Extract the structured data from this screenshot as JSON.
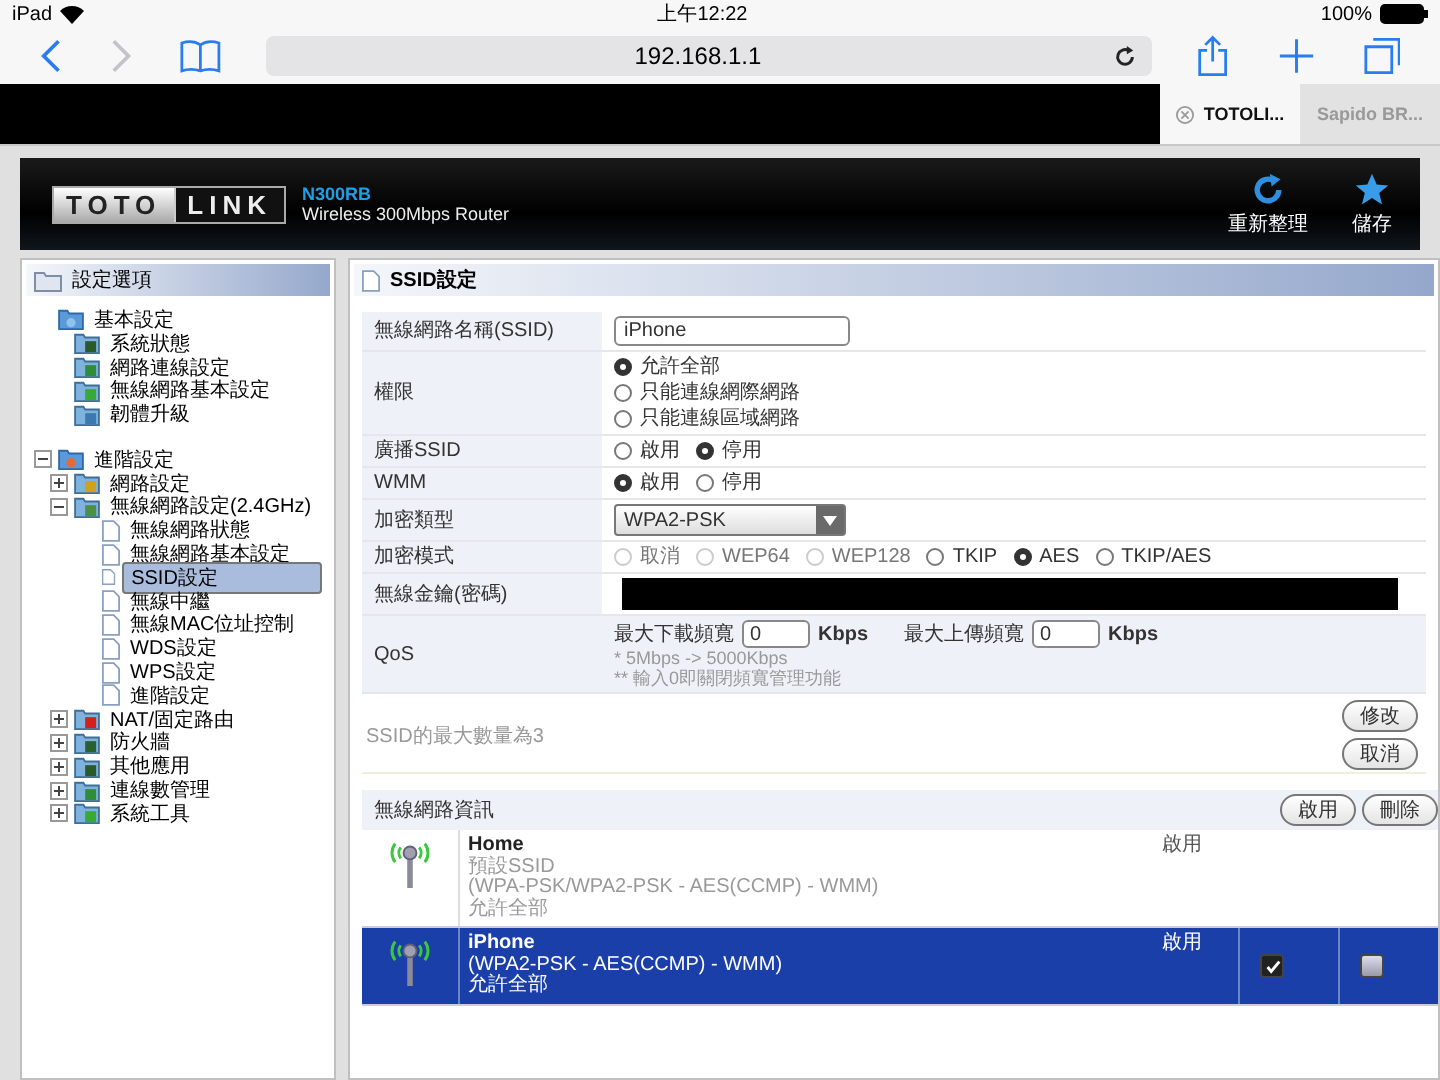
{
  "status_bar": {
    "device": "iPad",
    "time": "上午12:22",
    "battery": "100%"
  },
  "browser": {
    "url": "192.168.1.1",
    "tabs": [
      {
        "label": "TOTOLI...",
        "selected": true
      },
      {
        "label": "Sapido BR...",
        "selected": false
      }
    ]
  },
  "header": {
    "logo_left": "TOTO",
    "logo_right": "LINK",
    "model": "N300RB",
    "subtitle": "Wireless 300Mbps Router",
    "actions": [
      {
        "kind": "refresh",
        "label": "重新整理"
      },
      {
        "kind": "save",
        "label": "儲存"
      }
    ]
  },
  "sidebar": {
    "title": "設定選項",
    "tree": [
      {
        "label": "基本設定",
        "children": [
          {
            "label": "系統狀態"
          },
          {
            "label": "網路連線設定"
          },
          {
            "label": "無線網路基本設定"
          },
          {
            "label": "韌體升級"
          }
        ]
      },
      {
        "label": "進階設定",
        "expanded": true,
        "children": [
          {
            "label": "網路設定",
            "expanded": false
          },
          {
            "label": "無線網路設定(2.4GHz)",
            "expanded": true,
            "children": [
              {
                "label": "無線網路狀態",
                "selected": false
              },
              {
                "label": "無線網路基本設定",
                "selected": false
              },
              {
                "label": "SSID設定",
                "selected": true
              },
              {
                "label": "無線中繼",
                "selected": false
              },
              {
                "label": "無線MAC位址控制",
                "selected": false
              },
              {
                "label": "WDS設定",
                "selected": false
              },
              {
                "label": "WPS設定",
                "selected": false
              },
              {
                "label": "進階設定",
                "selected": false
              }
            ]
          },
          {
            "label": "NAT/固定路由",
            "expanded": false
          },
          {
            "label": "防火牆",
            "expanded": false
          },
          {
            "label": "其他應用",
            "expanded": false
          },
          {
            "label": "連線數管理",
            "expanded": false
          },
          {
            "label": "系統工具",
            "expanded": false
          }
        ]
      }
    ]
  },
  "panel": {
    "title": "SSID設定",
    "form": [
      {
        "kind": "text",
        "label": "無線網路名稱(SSID)",
        "value": "iPhone"
      },
      {
        "kind": "radio",
        "label": "權限",
        "stacked": true,
        "options": [
          {
            "label": "允許全部",
            "selected": true
          },
          {
            "label": "只能連線網際網路",
            "selected": false
          },
          {
            "label": "只能連線區域網路",
            "selected": false
          }
        ]
      },
      {
        "kind": "radio",
        "label": "廣播SSID",
        "stacked": false,
        "options": [
          {
            "label": "啟用",
            "selected": false
          },
          {
            "label": "停用",
            "selected": true
          }
        ]
      },
      {
        "kind": "radio",
        "label": "WMM",
        "stacked": false,
        "options": [
          {
            "label": "啟用",
            "selected": true
          },
          {
            "label": "停用",
            "selected": false
          }
        ]
      },
      {
        "kind": "select",
        "label": "加密類型",
        "value": "WPA2-PSK"
      },
      {
        "kind": "radio",
        "label": "加密模式",
        "stacked": false,
        "options": [
          {
            "label": "取消",
            "selected": false,
            "disabled": true
          },
          {
            "label": "WEP64",
            "selected": false,
            "disabled": true
          },
          {
            "label": "WEP128",
            "selected": false,
            "disabled": true
          },
          {
            "label": "TKIP",
            "selected": false,
            "disabled": false
          },
          {
            "label": "AES",
            "selected": true,
            "disabled": false
          },
          {
            "label": "TKIP/AES",
            "selected": false,
            "disabled": false
          }
        ]
      },
      {
        "kind": "key",
        "label": "無線金鑰(密碼)"
      },
      {
        "kind": "qos",
        "label": "QoS",
        "down_label": "最大下載頻寬",
        "down_value": "0",
        "up_label": "最大上傳頻寬",
        "up_value": "0",
        "down_unit": "Kbps",
        "up_unit": "Kbps",
        "notes": [
          "* 5Mbps -> 5000Kbps",
          "** 輸入0即關閉頻寬管理功能"
        ]
      }
    ],
    "ssid_limit": "SSID的最大數量為3",
    "buttons": [
      "修改",
      "取消"
    ]
  },
  "wireless": {
    "title": "無線網路資訊",
    "buttons": [
      "啟用",
      "刪除"
    ],
    "items": [
      {
        "name": "Home",
        "details": [
          "預設SSID",
          "(WPA-PSK/WPA2-PSK - AES(CCMP) - WMM)",
          "允許全部"
        ],
        "status": "啟用",
        "selected": false
      },
      {
        "name": "iPhone",
        "details": [
          "(WPA2-PSK - AES(CCMP) - WMM)",
          "允許全部"
        ],
        "status": "啟用",
        "selected": true,
        "enable_checked": true,
        "delete_checked": false
      }
    ]
  }
}
